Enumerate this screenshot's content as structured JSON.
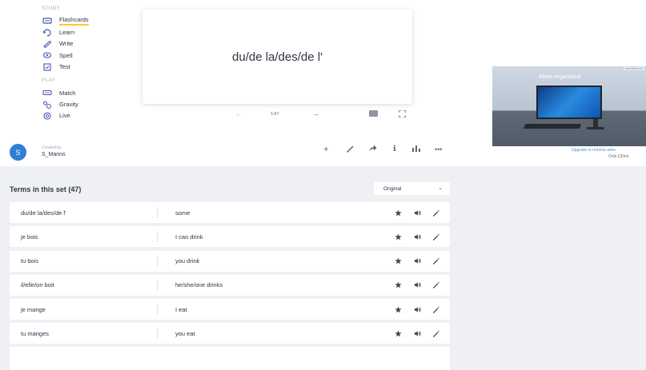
{
  "sidebar": {
    "study_label": "STUDY",
    "play_label": "PLAY",
    "study_items": [
      {
        "label": "Flashcards",
        "icon": "flashcards-icon"
      },
      {
        "label": "Learn",
        "icon": "learn-icon"
      },
      {
        "label": "Write",
        "icon": "write-icon"
      },
      {
        "label": "Spell",
        "icon": "spell-icon"
      },
      {
        "label": "Test",
        "icon": "test-icon"
      }
    ],
    "play_items": [
      {
        "label": "Match",
        "icon": "match-icon"
      },
      {
        "label": "Gravity",
        "icon": "gravity-icon"
      },
      {
        "label": "Live",
        "icon": "live-icon"
      }
    ]
  },
  "flashcard": {
    "term": "du/de la/des/de l'",
    "counter": "1/47"
  },
  "creator": {
    "created_by_label": "Created by",
    "name": "S_Manns",
    "avatar_letter": "S"
  },
  "ad": {
    "tag": "Advertisement",
    "headline": "More organised",
    "link": "Upgrade to remove adve",
    "price": "Only £3/mo"
  },
  "terms": {
    "title": "Terms in this set (47)",
    "sort_value": "Original",
    "rows": [
      {
        "term": "du/de la/des/de l'",
        "definition": "some"
      },
      {
        "term": "je bois",
        "definition": "I can drink"
      },
      {
        "term": "tu bois",
        "definition": "you drink"
      },
      {
        "term": "il/elle/on boit",
        "definition": "he/she/one drinks"
      },
      {
        "term": "je mange",
        "definition": "I eat"
      },
      {
        "term": "tu manges",
        "definition": "you eat"
      }
    ]
  },
  "colors": {
    "accent": "#4257b2",
    "underline": "#ffcd1f",
    "avatar": "#2f7fd4",
    "background_lower": "#eff0f3"
  }
}
